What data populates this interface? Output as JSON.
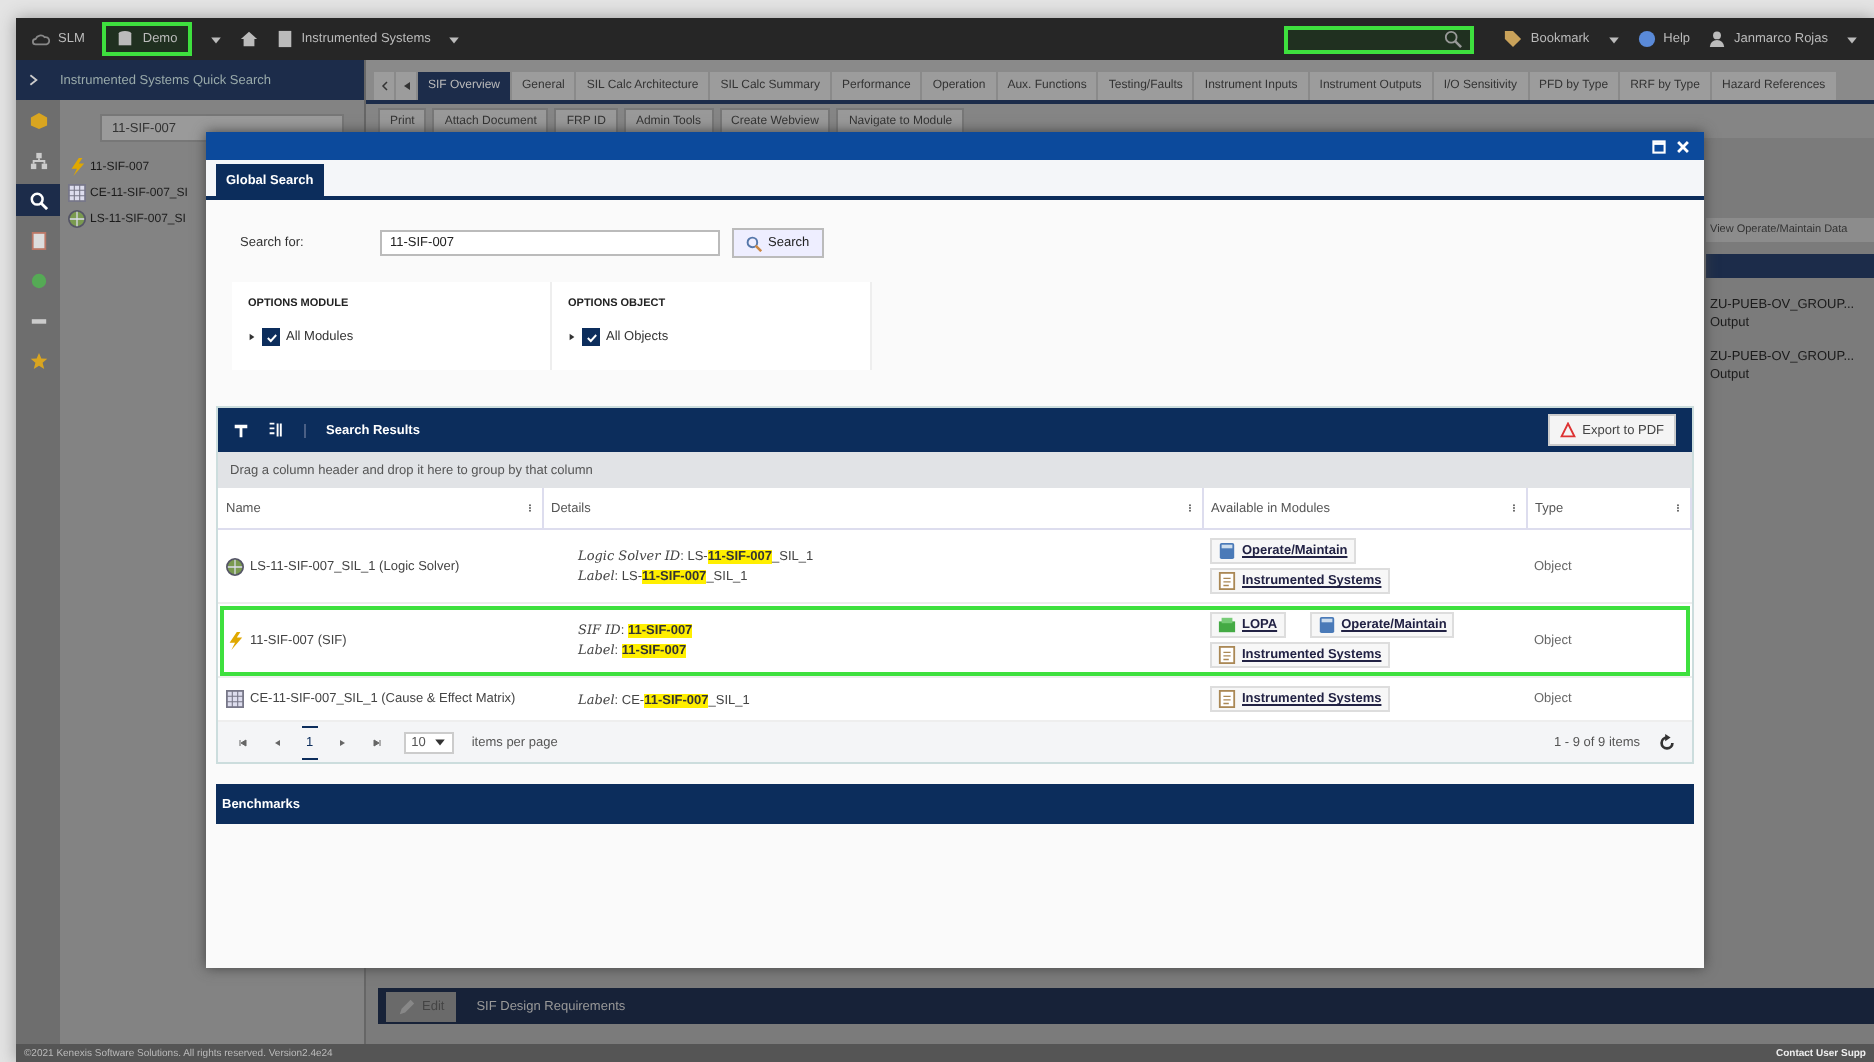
{
  "top_bar": {
    "app": "SLM",
    "database": {
      "label": "Demo",
      "highlighted": true
    },
    "module": "Instrumented Systems",
    "search": {
      "highlighted": true
    },
    "bookmark": "Bookmark",
    "help": "Help",
    "user": "Janmarco Rojas"
  },
  "rail": [
    {
      "kind": "cube",
      "selected": false
    },
    {
      "kind": "tree",
      "selected": false
    },
    {
      "kind": "search",
      "selected": true
    },
    {
      "kind": "doc",
      "selected": false
    },
    {
      "kind": "node",
      "selected": false
    },
    {
      "kind": "bar",
      "selected": false
    },
    {
      "kind": "star",
      "selected": false
    }
  ],
  "sidebar": {
    "title": "Instrumented Systems Quick Search",
    "search": {
      "value": "11-SIF-007"
    },
    "results": [
      {
        "kind": "sif",
        "label": "11-SIF-007"
      },
      {
        "kind": "matrix",
        "label": "CE-11-SIF-007_SI"
      },
      {
        "kind": "solver",
        "label": "LS-11-SIF-007_SI"
      }
    ]
  },
  "tabs": [
    {
      "label": "SIF Overview",
      "selected": true
    },
    {
      "label": "General",
      "selected": false
    },
    {
      "label": "SIL Calc Architecture",
      "selected": false
    },
    {
      "label": "SIL Calc Summary",
      "selected": false
    },
    {
      "label": "Performance",
      "selected": false
    },
    {
      "label": "Operation",
      "selected": false
    },
    {
      "label": "Aux. Functions",
      "selected": false
    },
    {
      "label": "Testing/Faults",
      "selected": false
    },
    {
      "label": "Instrument Inputs",
      "selected": false
    },
    {
      "label": "Instrument Outputs",
      "selected": false
    },
    {
      "label": "I/O Sensitivity",
      "selected": false
    },
    {
      "label": "PFD by Type",
      "selected": false
    },
    {
      "label": "RRF by Type",
      "selected": false
    },
    {
      "label": "Hazard References",
      "selected": false
    }
  ],
  "toolbar": [
    "Print",
    "Attach Document",
    "FRP ID",
    "Admin Tools",
    "Create Webview",
    "Navigate to Module"
  ],
  "right_panel": {
    "button": "View Operate/Maintain Data",
    "items": [
      {
        "title": "ZU-PUEB-OV_GROUP...",
        "subtitle": "Output"
      },
      {
        "title": "ZU-PUEB-OV_GROUP...",
        "subtitle": "Output"
      }
    ]
  },
  "bottom_panel": {
    "edit_button": "Edit",
    "title": "SIF Design Requirements"
  },
  "dialog": {
    "tab": "Global Search",
    "search_label": "Search for:",
    "search": {
      "value": "11-SIF-007"
    },
    "search_button": "Search",
    "options": [
      {
        "title": "OPTIONS MODULE",
        "label": "All Modules",
        "checked": true
      },
      {
        "title": "OPTIONS OBJECT",
        "label": "All Objects",
        "checked": true
      }
    ],
    "grid": {
      "title": "Search Results",
      "export_button": "Export to PDF",
      "group_hint": "Drag a column header and drop it here to group by that column",
      "columns": [
        "Name",
        "Details",
        "Available in Modules",
        "Type"
      ],
      "rows": [
        {
          "kind": "solver",
          "name": "LS-11-SIF-007_SIL_1 (Logic Solver)",
          "details": [
            "*Logic Solver ID*: LS-**11-SIF-007**_SIL_1",
            "*Label*: LS-**11-SIF-007**_SIL_1"
          ],
          "modules": [
            {
              "kind": "operate",
              "label": "Operate/Maintain"
            },
            {
              "kind": "instrumented",
              "label": "Instrumented Systems"
            }
          ],
          "type": "Object",
          "highlighted": false
        },
        {
          "kind": "sif",
          "name": "11-SIF-007 (SIF)",
          "details": [
            "*SIF ID*: **11-SIF-007**",
            "*Label*: **11-SIF-007**"
          ],
          "modules": [
            {
              "kind": "lopa",
              "label": "LOPA"
            },
            {
              "kind": "operate",
              "label": "Operate/Maintain"
            },
            {
              "kind": "instrumented",
              "label": "Instrumented Systems"
            }
          ],
          "type": "Object",
          "highlighted": true
        },
        {
          "kind": "matrix",
          "name": "CE-11-SIF-007_SIL_1 (Cause & Effect Matrix)",
          "details": [
            "*Label*: CE-**11-SIF-007**_SIL_1"
          ],
          "modules": [
            {
              "kind": "instrumented",
              "label": "Instrumented Systems"
            }
          ],
          "type": "Object",
          "highlighted": false
        }
      ],
      "pager": {
        "page": "1",
        "page_size": "10",
        "page_size_label": "items per page",
        "summary": "1 - 9 of 9 items"
      }
    },
    "benchmarks": "Benchmarks"
  },
  "footer": {
    "copyright": "©2021 Kenexis Software Solutions. All rights reserved. Version2.4e24",
    "contact": "Contact User Supp"
  }
}
